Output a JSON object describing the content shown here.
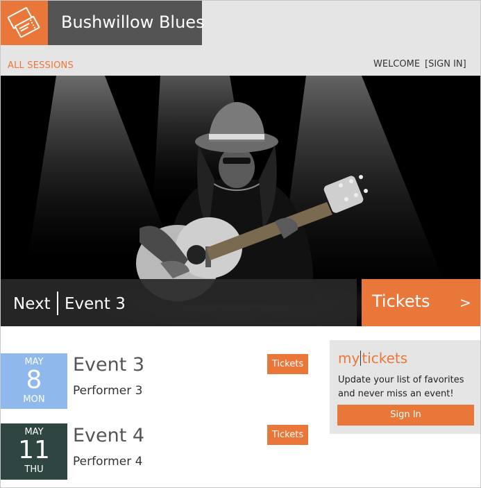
{
  "app": {
    "title": "Bushwillow Blues"
  },
  "colors": {
    "accent": "#e9773a",
    "dark": "#545454",
    "may8": "#8fb8ec",
    "may11": "#2f4541"
  },
  "nav": {
    "all_sessions": "ALL SESSIONS",
    "welcome": "WELCOME",
    "sign_in": "[SIGN IN]"
  },
  "hero": {
    "image": "musician-with-guitar",
    "next_label": "Next",
    "next_event": "Event 3",
    "tickets_label": "Tickets",
    "tickets_arrow": ">"
  },
  "events": [
    {
      "month": "MAY",
      "day": "8",
      "weekday": "MON",
      "title": "Event 3",
      "performer": "Performer 3",
      "button": "Tickets"
    },
    {
      "month": "MAY",
      "day": "11",
      "weekday": "THU",
      "title": "Event 4",
      "performer": "Performer 4",
      "button": "Tickets"
    }
  ],
  "mytickets": {
    "logo_prefix": "my",
    "logo_suffix": "tickets",
    "text": "Update your list of favorites and never miss an event!",
    "button": "Sign In"
  }
}
